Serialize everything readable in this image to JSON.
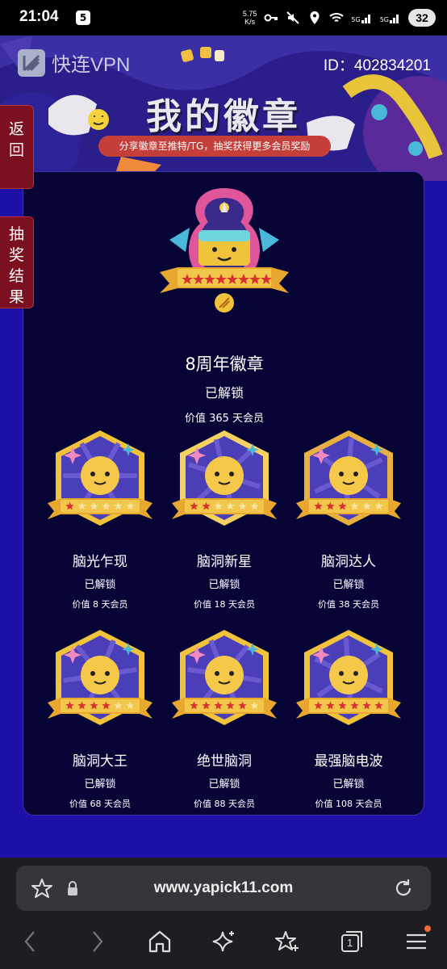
{
  "status_bar": {
    "time": "21:04",
    "net_speed_value": "5.75",
    "net_speed_unit": "K/s",
    "battery": "32",
    "signal_labels": [
      "5G",
      "5G"
    ],
    "app_icon": "5"
  },
  "header": {
    "app_name": "快连VPN",
    "user_id": "ID：402834201",
    "title": "我的徽章",
    "subtitle": "分享徽章至推特/TG，抽奖获得更多会员奖励"
  },
  "side_tabs": [
    {
      "label": "返回",
      "chars": [
        "返",
        "回"
      ]
    },
    {
      "label": "抽奖结果",
      "chars": [
        "抽",
        "奖",
        "结",
        "果"
      ]
    }
  ],
  "featured_badge": {
    "name": "8周年徽章",
    "status": "已解锁",
    "value": "价值 365 天会员",
    "colors": {
      "ring": "#e0569a",
      "ribbon": "#e8a830"
    }
  },
  "badges": [
    {
      "name": "脑光乍现",
      "status": "已解锁",
      "value": "价值 8 天会员",
      "stars": 1,
      "bg": "#4a3fb8",
      "accent": "#f0c33a"
    },
    {
      "name": "脑洞新星",
      "status": "已解锁",
      "value": "价值 18 天会员",
      "stars": 2,
      "bg": "#4b3fb8",
      "accent": "#f5d260"
    },
    {
      "name": "脑洞达人",
      "status": "已解锁",
      "value": "价值 38 天会员",
      "stars": 3,
      "bg": "#4a3fb8",
      "accent": "#e8b040"
    },
    {
      "name": "脑洞大王",
      "status": "已解锁",
      "value": "价值 68 天会员",
      "stars": 4,
      "bg": "#4a3fb8",
      "accent": "#f0c33a"
    },
    {
      "name": "绝世脑洞",
      "status": "已解锁",
      "value": "价值 88 天会员",
      "stars": 5,
      "bg": "#4a3fb8",
      "accent": "#f0c33a"
    },
    {
      "name": "最强脑电波",
      "status": "已解锁",
      "value": "价值 108 天会员",
      "stars": 6,
      "bg": "#4a3fb8",
      "accent": "#f0c33a"
    }
  ],
  "browser": {
    "url": "www.yapick11.com",
    "icons": [
      "star-outline-icon",
      "lock-icon",
      "reload-icon",
      "back-icon",
      "forward-icon",
      "home-icon",
      "sparkle-icon",
      "star-plus-icon",
      "tabs-icon",
      "menu-icon"
    ],
    "tab_count": "1"
  },
  "colors": {
    "page_bg": "#1c10a8",
    "panel_bg": "#070436",
    "side_tab": "#7a1020",
    "banner_pill": "#c43e3a"
  }
}
